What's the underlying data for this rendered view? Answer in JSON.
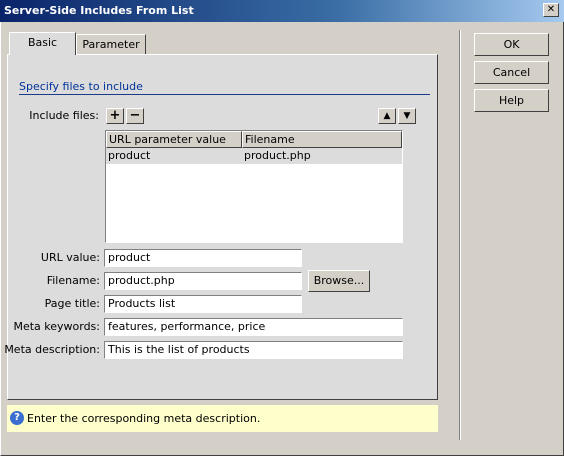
{
  "window": {
    "title": "Server-Side Includes From List",
    "close_glyph": "✕"
  },
  "tabs": [
    {
      "label": "Basic",
      "active": true
    },
    {
      "label": "Parameter",
      "active": false
    }
  ],
  "section": {
    "label": "Specify files to include"
  },
  "include_files": {
    "label": "Include files:",
    "add_glyph": "+",
    "remove_glyph": "−",
    "up_glyph": "▲",
    "down_glyph": "▼",
    "columns": [
      "URL parameter value",
      "Filename"
    ],
    "rows": [
      {
        "url": "product",
        "filename": "product.php",
        "selected": true
      }
    ]
  },
  "fields": {
    "url_value": {
      "label": "URL value:",
      "value": "product"
    },
    "filename": {
      "label": "Filename:",
      "value": "product.php",
      "browse_label": "Browse..."
    },
    "page_title": {
      "label": "Page title:",
      "value": "Products list"
    },
    "meta_keywords": {
      "label": "Meta keywords:",
      "value": "features, performance, price"
    },
    "meta_description": {
      "label": "Meta description:",
      "value": "This is the list of products"
    }
  },
  "buttons": {
    "ok": "OK",
    "cancel": "Cancel",
    "help": "Help"
  },
  "hint": {
    "icon": "?",
    "text": "Enter the corresponding meta description."
  }
}
